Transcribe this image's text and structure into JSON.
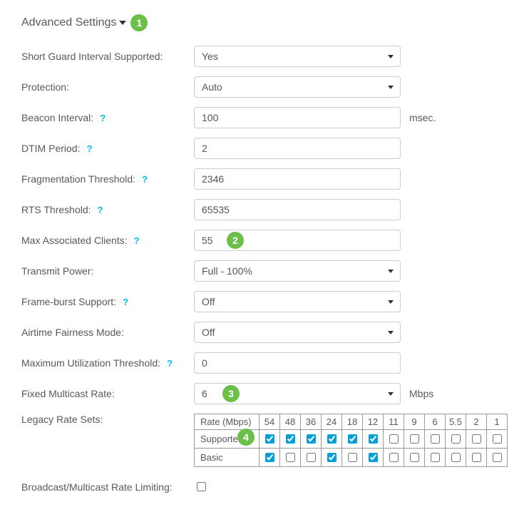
{
  "section": {
    "title": "Advanced Settings"
  },
  "callouts": {
    "c1": "1",
    "c2": "2",
    "c3": "3",
    "c4": "4"
  },
  "labels": {
    "sgi": "Short Guard Interval Supported:",
    "protection": "Protection:",
    "beacon": "Beacon Interval:",
    "dtim": "DTIM Period:",
    "frag": "Fragmentation Threshold:",
    "rts": "RTS Threshold:",
    "maxclients": "Max Associated Clients:",
    "txpower": "Transmit Power:",
    "frameburst": "Frame-burst Support:",
    "airtime": "Airtime Fairness Mode:",
    "maxutil": "Maximum Utilization Threshold:",
    "multicast": "Fixed Multicast Rate:",
    "legacy": "Legacy Rate Sets:",
    "bmrate": "Broadcast/Multicast Rate Limiting:"
  },
  "values": {
    "sgi": "Yes",
    "protection": "Auto",
    "beacon": "100",
    "dtim": "2",
    "frag": "2346",
    "rts": "65535",
    "maxclients": "55",
    "txpower": "Full - 100%",
    "frameburst": "Off",
    "airtime": "Off",
    "maxutil": "0",
    "multicast": "6"
  },
  "units": {
    "msec": "msec.",
    "mbps": "Mbps"
  },
  "rates_table": {
    "header": "Rate (Mbps)",
    "supported_label": "Supported",
    "basic_label": "Basic",
    "rates": [
      "54",
      "48",
      "36",
      "24",
      "18",
      "12",
      "11",
      "9",
      "6",
      "5.5",
      "2",
      "1"
    ],
    "supported": [
      true,
      true,
      true,
      true,
      true,
      true,
      false,
      false,
      false,
      false,
      false,
      false
    ],
    "basic": [
      true,
      false,
      false,
      true,
      false,
      true,
      false,
      false,
      false,
      false,
      false,
      false
    ]
  },
  "help_glyph": "?"
}
